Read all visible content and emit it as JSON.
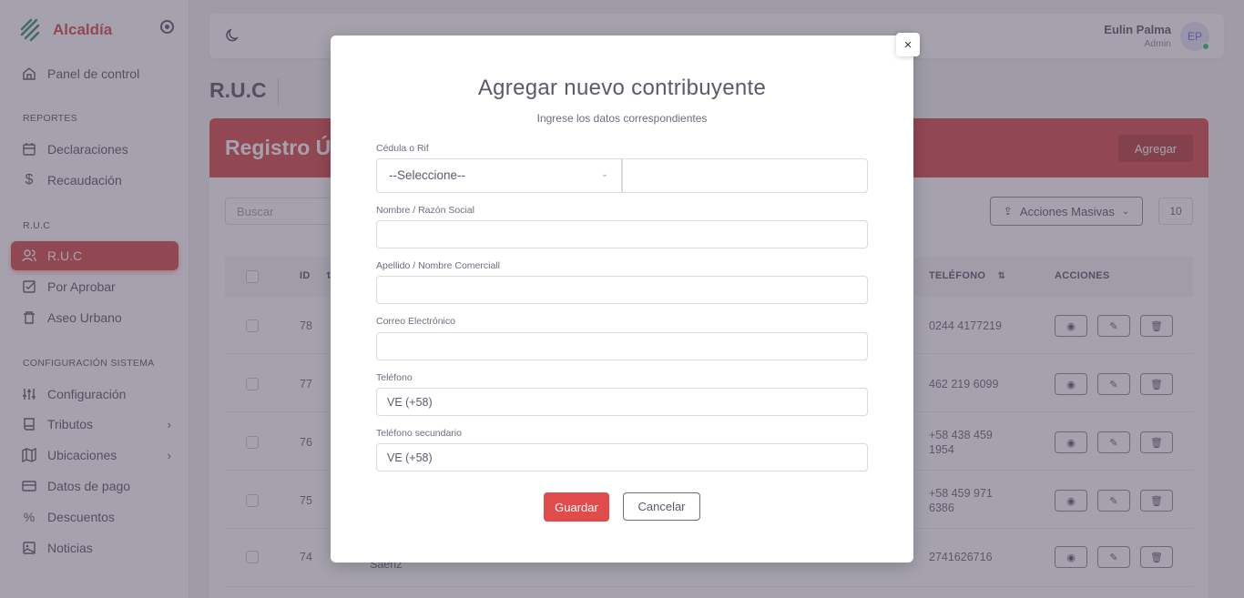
{
  "sidebar": {
    "brand": "Alcaldía",
    "sections": {
      "reportes": "REPORTES",
      "ruc": "R.U.C",
      "config": "CONFIGURACIÓN SISTEMA"
    },
    "items": [
      {
        "label": "Panel de control",
        "icon": "home-icon"
      },
      {
        "label": "Declaraciones",
        "icon": "calendar-icon"
      },
      {
        "label": "Recaudación",
        "icon": "dollar-icon"
      },
      {
        "label": "R.U.C",
        "icon": "users-icon",
        "active": true
      },
      {
        "label": "Por Aprobar",
        "icon": "checkbox-icon"
      },
      {
        "label": "Aseo Urbano",
        "icon": "trash-icon"
      },
      {
        "label": "Configuración",
        "icon": "sliders-icon"
      },
      {
        "label": "Tributos",
        "icon": "book-icon",
        "chevron": "›"
      },
      {
        "label": "Ubicaciones",
        "icon": "map-icon",
        "chevron": "›"
      },
      {
        "label": "Datos de pago",
        "icon": "credit-card-icon"
      },
      {
        "label": "Descuentos",
        "icon": "percent-icon"
      },
      {
        "label": "Noticias",
        "icon": "image-icon"
      }
    ]
  },
  "header": {
    "user_name": "Eulin Palma",
    "user_role": "Admin",
    "avatar_initials": "EP"
  },
  "page": {
    "title": "R.U.C",
    "card_title": "Registro Ú",
    "add_label": "Agregar",
    "search_placeholder": "Buscar",
    "bulk_label": "Acciones Masivas",
    "page_size": "10",
    "columns": {
      "id": "ID",
      "telefono": "TELÉFONO",
      "acciones": "ACCIONES"
    },
    "rows": [
      {
        "id": "78",
        "telefono": "0244 4177219"
      },
      {
        "id": "77",
        "telefono": "462 219 6099"
      },
      {
        "id": "76",
        "telefono": "+58 438 459",
        "telefono2": "1954"
      },
      {
        "id": "75",
        "telefono": "+58 459 971",
        "telefono2": "6386"
      },
      {
        "id": "74",
        "telefono": "2741626716",
        "name_fragment": "Saenz"
      }
    ]
  },
  "modal": {
    "close": "×",
    "title": "Agregar nuevo contribuyente",
    "subtitle": "Ingrese los datos correspondientes",
    "fields": {
      "cedula_label": "Cédula o Rif",
      "cedula_select": "--Seleccione--",
      "nombre_label": "Nombre / Razón Social",
      "apellido_label": "Apellido / Nombre Comerciall",
      "correo_label": "Correo Electrónico",
      "telefono_label": "Teléfono",
      "telefono_value": "VE (+58)",
      "telefono2_label": "Teléfono secundario",
      "telefono2_value": "VE (+58)"
    },
    "save_label": "Guardar",
    "cancel_label": "Cancelar"
  },
  "colors": {
    "accent": "#d94b4b",
    "overlay": "#4b465c"
  }
}
